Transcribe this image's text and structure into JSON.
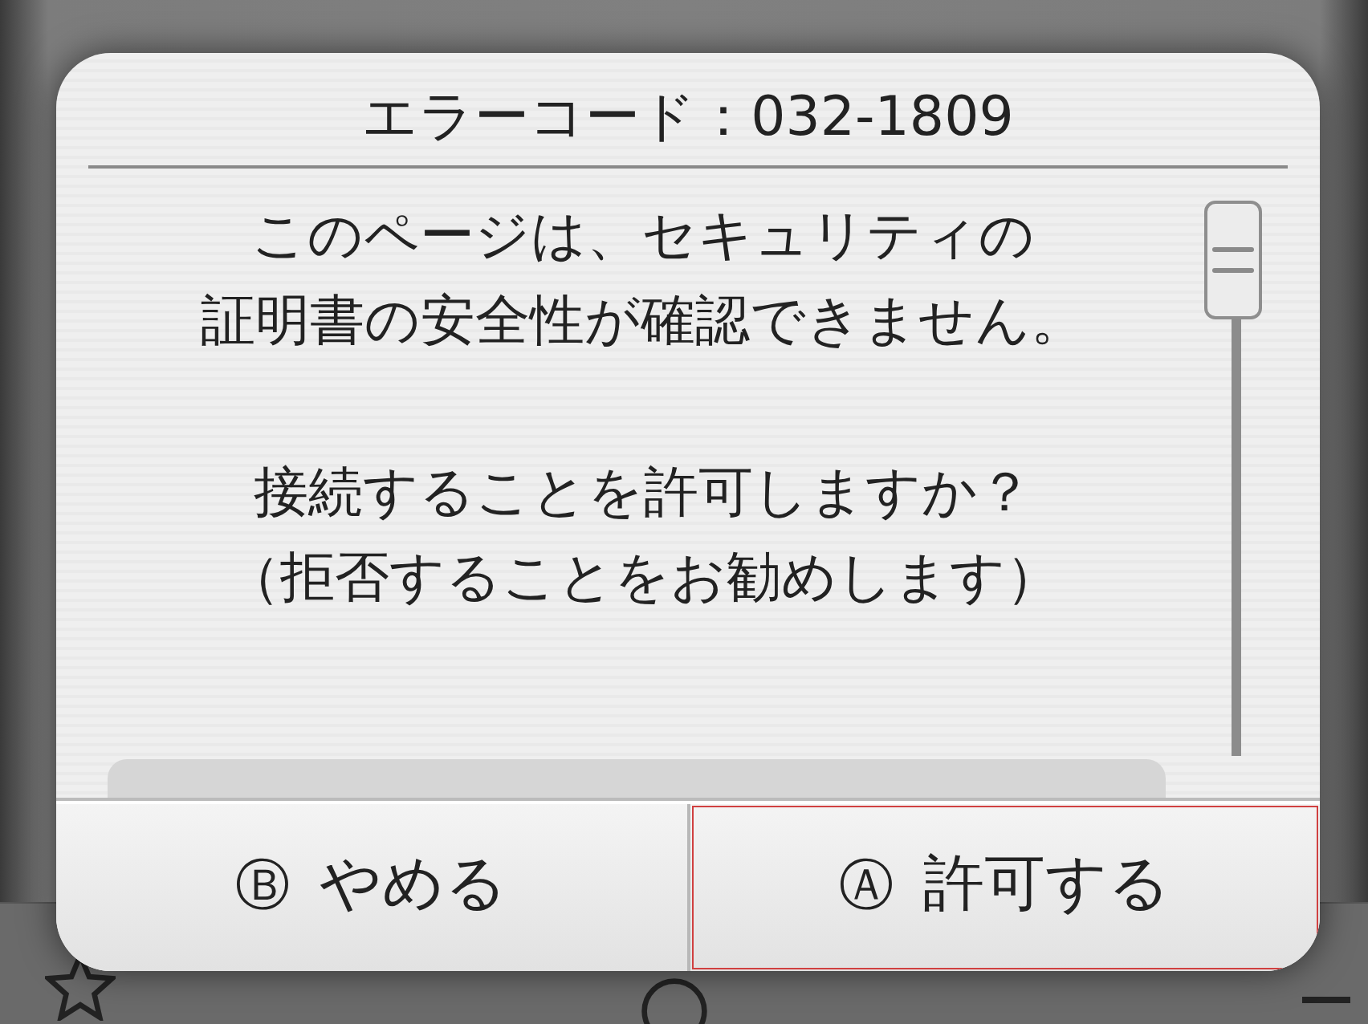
{
  "dialog": {
    "title": "エラーコード：032-1809",
    "paragraphs": [
      {
        "lines": [
          "このページは、セキュリティの",
          "証明書の安全性が確認できません。"
        ]
      },
      {
        "lines": [
          "接続することを許可しますか？",
          "（拒否することをお勧めします）"
        ]
      }
    ],
    "buttons": [
      {
        "key": "Ⓑ",
        "label": "やめる",
        "selected": false
      },
      {
        "key": "Ⓐ",
        "label": "許可する",
        "selected": true
      }
    ]
  }
}
